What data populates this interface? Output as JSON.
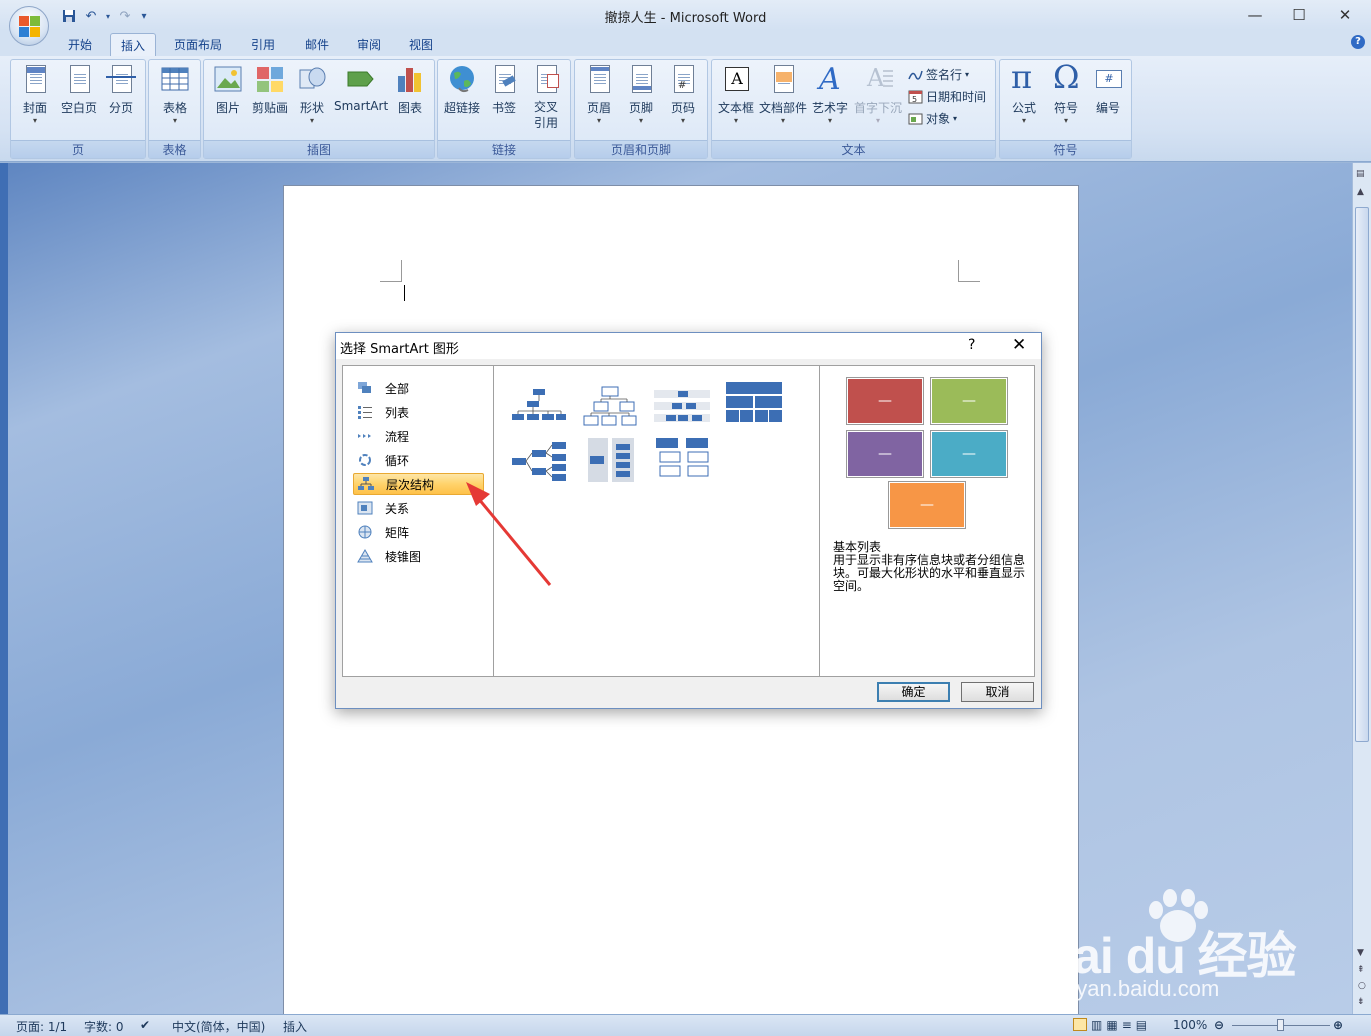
{
  "window": {
    "title": "撤掠人生 - Microsoft Word",
    "minimize": "—",
    "maximize": "☐",
    "close": "✕"
  },
  "qat": {
    "save": "save-icon",
    "undo": "↶",
    "redo": "↷",
    "customize": "▾"
  },
  "tabs": [
    "开始",
    "插入",
    "页面布局",
    "引用",
    "邮件",
    "审阅",
    "视图"
  ],
  "active_tab": "插入",
  "ribbon": {
    "groups": [
      {
        "label": "页",
        "buttons": [
          "封面",
          "空白页",
          "分页"
        ]
      },
      {
        "label": "表格",
        "buttons": [
          "表格"
        ]
      },
      {
        "label": "插图",
        "buttons": [
          "图片",
          "剪贴画",
          "形状",
          "SmartArt",
          "图表"
        ]
      },
      {
        "label": "链接",
        "buttons": [
          "超链接",
          "书签",
          "交叉\n引用"
        ]
      },
      {
        "label": "页眉和页脚",
        "buttons": [
          "页眉",
          "页脚",
          "页码"
        ]
      },
      {
        "label": "文本",
        "buttons": [
          "文本框",
          "文档部件",
          "艺术字",
          "首字下沉"
        ],
        "small": [
          "签名行",
          "日期和时间",
          "对象"
        ]
      },
      {
        "label": "符号",
        "buttons": [
          "公式",
          "符号",
          "编号"
        ]
      }
    ]
  },
  "dialog": {
    "title": "选择 SmartArt 图形",
    "help": "?",
    "close": "✕",
    "categories": [
      "全部",
      "列表",
      "流程",
      "循环",
      "层次结构",
      "关系",
      "矩阵",
      "棱锥图"
    ],
    "selected_category": "层次结构",
    "preview_name": "基本列表",
    "preview_desc": "用于显示非有序信息块或者分组信息块。可最大化形状的水平和垂直显示空间。",
    "ok": "确定",
    "cancel": "取消",
    "preview_colors": [
      "#c0504d",
      "#9bbb59",
      "#8064a2",
      "#4bacc6",
      "#f79646"
    ]
  },
  "status": {
    "page": "页面: 1/1",
    "words": "字数: 0",
    "lang": "中文(简体，中国)",
    "mode": "插入",
    "zoom": "100%"
  },
  "watermark": {
    "big": "Bai du 经验",
    "small": "jingyan.baidu.com"
  }
}
